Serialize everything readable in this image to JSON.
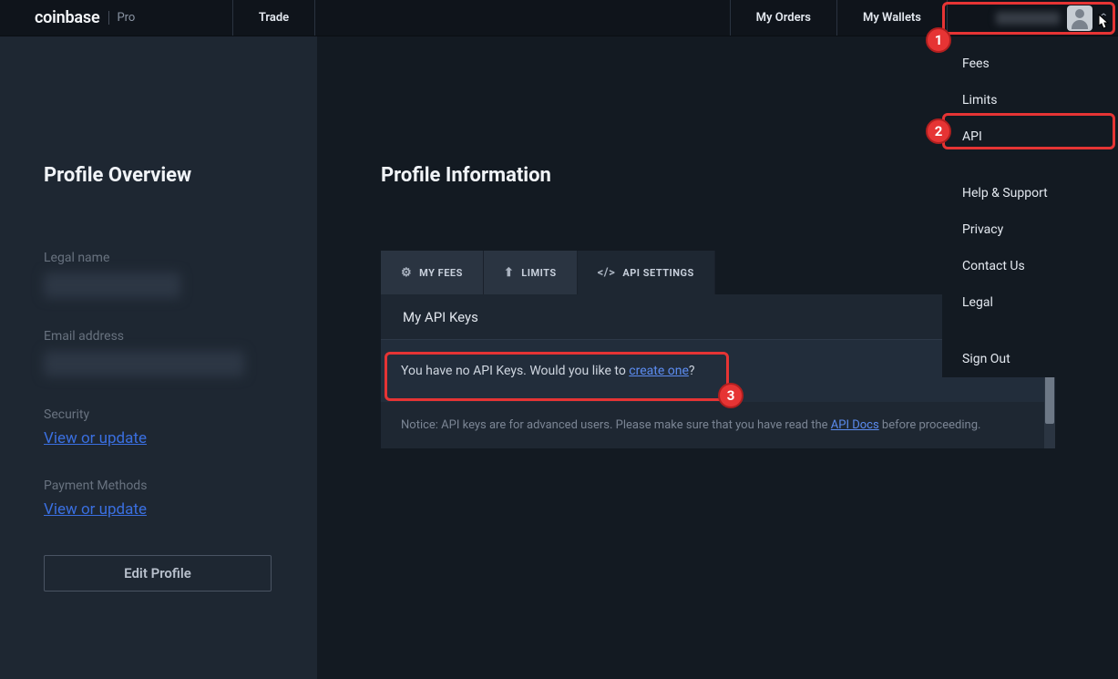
{
  "header": {
    "logo_main": "coinbase",
    "logo_sub": "Pro",
    "trade": "Trade",
    "my_orders": "My Orders",
    "my_wallets": "My Wallets"
  },
  "dropdown": {
    "items": [
      "Fees",
      "Limits",
      "API",
      "Help & Support",
      "Privacy",
      "Contact Us",
      "Legal",
      "Sign Out"
    ]
  },
  "sidebar": {
    "title": "Profile Overview",
    "legal_label": "Legal name",
    "email_label": "Email address",
    "security_label": "Security",
    "security_link": "View or update",
    "payment_label": "Payment Methods",
    "payment_link": "View or update",
    "edit_btn": "Edit Profile"
  },
  "main": {
    "title": "Profile Information",
    "tabs": {
      "fees": "MY FEES",
      "limits": "LIMITS",
      "api": "API SETTINGS"
    },
    "panel_title": "My API Keys",
    "new_key_btn": "+",
    "api_msg_pre": "You have no API Keys. Would you like to ",
    "api_msg_link": "create one",
    "api_msg_post": "?",
    "notice_pre": "Notice: API keys are for advanced users. Please make sure that you have read the ",
    "notice_link": "API Docs",
    "notice_post": " before proceeding."
  },
  "badges": {
    "b1": "1",
    "b2": "2",
    "b3": "3"
  }
}
